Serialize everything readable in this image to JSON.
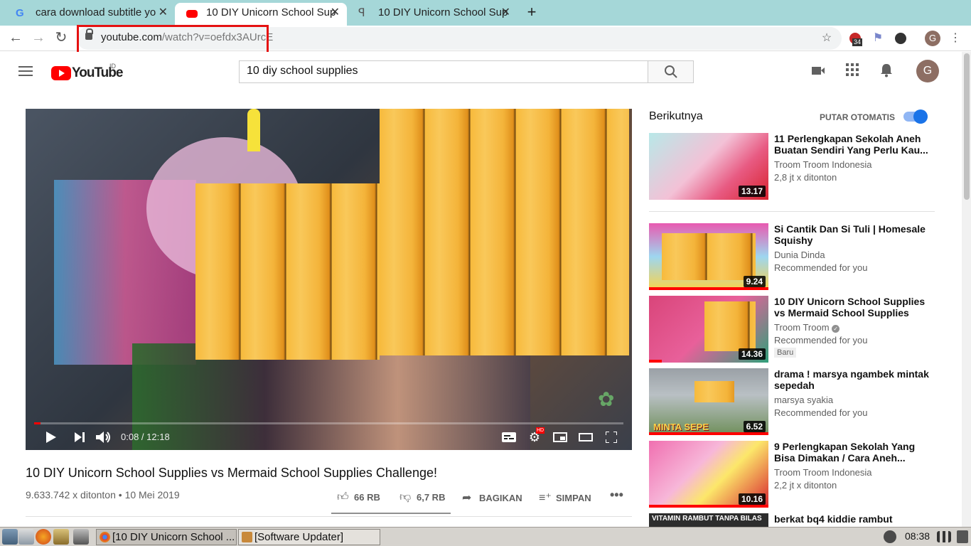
{
  "browser": {
    "tabs": [
      {
        "title": "cara download subtitle yo",
        "favicon": "google-g"
      },
      {
        "title": "10 DIY Unicorn School Sup",
        "favicon": "youtube-play",
        "active": true
      },
      {
        "title": "10 DIY Unicorn School Sup",
        "favicon": "pinterest-like"
      }
    ],
    "url_domain": "youtube.com",
    "url_path": "/watch?v=oefdx3AUrcE",
    "extension_badge": "34",
    "profile_initial": "G"
  },
  "youtube": {
    "brand": "YouTube",
    "region": "ID",
    "search_query": "10 diy school supplies",
    "avatar_initial": "G",
    "player": {
      "time_current": "0:08",
      "time_total": "12:18",
      "progress_fraction": 0.011
    },
    "video": {
      "title": "10 DIY Unicorn School Supplies vs Mermaid School Supplies Challenge!",
      "views_date": "9.633.742 x ditonton • 10 Mei 2019",
      "likes": "66 RB",
      "dislikes": "6,7 RB",
      "share": "BAGIKAN",
      "save": "SIMPAN"
    },
    "sidebar": {
      "up_next": "Berikutnya",
      "autoplay": "PUTAR OTOMATIS",
      "items": [
        {
          "title": "11 Perlengkapan Sekolah Aneh Buatan Sendiri Yang Perlu Kau...",
          "channel": "Troom Troom Indonesia",
          "meta": "2,8 jt x ditonton",
          "duration": "13.17"
        },
        {
          "title": "Si Cantik Dan Si Tuli | Homesale Squishy",
          "channel": "Dunia Dinda",
          "meta": "Recommended for you",
          "duration": "9.24"
        },
        {
          "title": "10 DIY Unicorn School Supplies vs Mermaid School Supplies",
          "channel": "Troom Troom",
          "meta": "Recommended for you",
          "badge": "Baru",
          "duration": "14.36"
        },
        {
          "title": "drama ! marsya ngambek mintak sepedah",
          "channel": "marsya syakia",
          "meta": "Recommended for you",
          "duration": "6.52",
          "overlay": "MINTA SEPE"
        },
        {
          "title": "9 Perlengkapan Sekolah Yang Bisa Dimakan / Cara Aneh...",
          "channel": "Troom Troom Indonesia",
          "meta": "2,2 jt x ditonton",
          "duration": "10.16"
        },
        {
          "title": "berkat bq4 kiddie rambut",
          "overlay": "VITAMIN RAMBUT TANPA BILAS"
        }
      ]
    }
  },
  "taskbar": {
    "tasks": [
      "[10 DIY Unicorn School ...",
      "[Software Updater]"
    ],
    "clock": "08:38"
  }
}
